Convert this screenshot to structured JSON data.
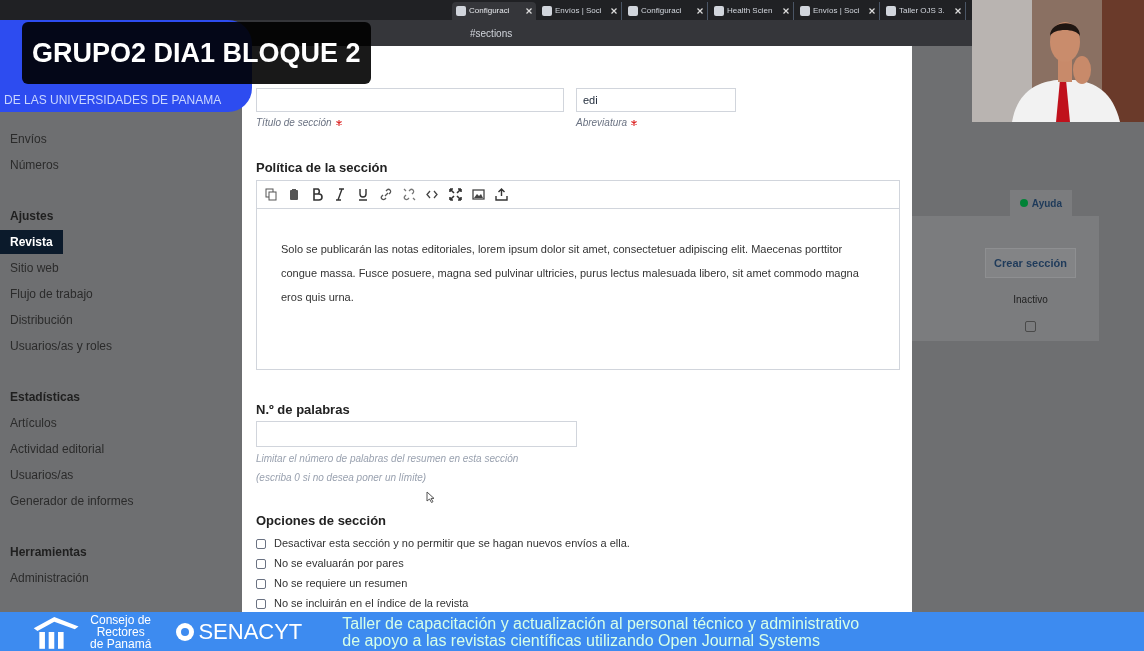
{
  "browser": {
    "tabs": [
      {
        "label": "Configuraci",
        "selected": true
      },
      {
        "label": "Envíos | Soci",
        "selected": false
      },
      {
        "label": "Configuraci",
        "selected": false
      },
      {
        "label": "Health Scien",
        "selected": false
      },
      {
        "label": "Envíos | Soci",
        "selected": false
      },
      {
        "label": "Taller OJS 3.",
        "selected": false
      }
    ],
    "address": "#sections"
  },
  "program_banner": {
    "subtitle": "DE LAS UNIVERSIDADES  DE PANAMA"
  },
  "session_badge": "GRUPO2 DIA1 BLOQUE 2",
  "sidebar": {
    "items": [
      {
        "label": "Envíos",
        "kind": "link",
        "selected": false
      },
      {
        "label": "Números",
        "kind": "link",
        "selected": false
      },
      {
        "label": "Ajustes",
        "kind": "heading"
      },
      {
        "label": "Revista",
        "kind": "link",
        "selected": true
      },
      {
        "label": "Sitio web",
        "kind": "link",
        "selected": false
      },
      {
        "label": "Flujo de trabajo",
        "kind": "link",
        "selected": false
      },
      {
        "label": "Distribución",
        "kind": "link",
        "selected": false
      },
      {
        "label": "Usuarios/as y roles",
        "kind": "link",
        "selected": false
      },
      {
        "label": "Estadísticas",
        "kind": "heading"
      },
      {
        "label": "Artículos",
        "kind": "link",
        "selected": false
      },
      {
        "label": "Actividad editorial",
        "kind": "link",
        "selected": false
      },
      {
        "label": "Usuarios/as",
        "kind": "link",
        "selected": false
      },
      {
        "label": "Generador de informes",
        "kind": "link",
        "selected": false
      },
      {
        "label": "Herramientas",
        "kind": "heading"
      },
      {
        "label": "Administración",
        "kind": "link",
        "selected": false
      }
    ]
  },
  "form": {
    "fields": [
      {
        "label": "Título de sección",
        "required": true
      },
      {
        "value": "edi",
        "label": "Abreviatura",
        "required": true
      }
    ],
    "policy": {
      "label": "Política de la sección",
      "text": "Solo se publicarán las notas editoriales, lorem ipsum dolor sit amet, consectetuer adipiscing elit. Maecenas porttitor congue massa. Fusce posuere, magna sed pulvinar ultricies, purus lectus malesuada libero, sit amet commodo magna eros quis urna."
    },
    "word_count": {
      "label": "N.º de palabras",
      "help": [
        "Limitar el número de palabras del resumen en esta sección",
        "(escriba 0 si no desea poner un límite)"
      ]
    },
    "options": {
      "label": "Opciones de sección",
      "items": [
        {
          "label": "Desactivar esta sección y no permitir que se hagan nuevos envíos a ella.",
          "checked": false
        },
        {
          "label": "No se evaluarán por pares",
          "checked": false
        },
        {
          "label": "No se requiere un resumen",
          "checked": false
        },
        {
          "label": "No se incluirán en el índice de la revista",
          "checked": false
        }
      ]
    }
  },
  "help_tab": "Ayuda",
  "sections_panel": {
    "button": "Crear sección",
    "column": "Inactivo",
    "inactive_checked": false
  },
  "footer_banner": {
    "org_lines": [
      "Consejo de",
      "Rectores",
      "de Panamá"
    ],
    "sponsor": "SENACYT",
    "caption": [
      "Taller de capacitación y actualización al personal técnico y administrativo",
      "de apoyo a las revistas científicas utilizando Open Journal Systems"
    ]
  }
}
